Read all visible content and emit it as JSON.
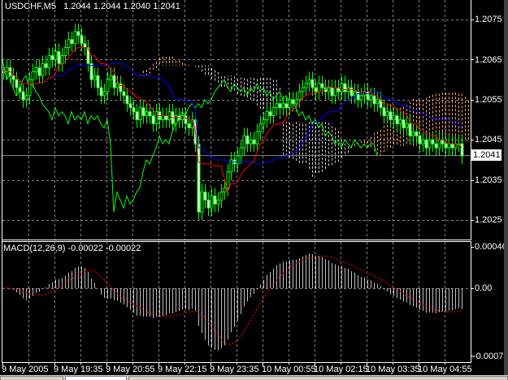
{
  "header": {
    "symbol": "USDCHF,M5",
    "ohlc": "1.2044 1.2044 1.2040 1.2041"
  },
  "current_price": "1.2041",
  "colors": {
    "background": "#000000",
    "grid": "#808080",
    "candle": "#00ff00",
    "tenkan": "#ff0000",
    "kijun": "#0000ff",
    "chikou": "#00ff00",
    "cloud_up": "#f4a460",
    "cloud_down": "#d8bfd8",
    "macd_histogram": "#c0c0c0",
    "macd_signal": "#ff0000"
  },
  "chart_data": [
    {
      "type": "candlestick",
      "title": "USDCHF,M5",
      "indicator": "Ichimoku",
      "ylim": [
        1.2025,
        1.2075
      ],
      "y_ticks": [
        "1.2075",
        "1.2065",
        "1.2055",
        "1.2045",
        "1.2035",
        "1.2025"
      ],
      "x_tick_labels": [
        "9 May 2005",
        "9 May 19:35",
        "9 May 20:55",
        "9 May 22:15",
        "9 May 23:35",
        "10 May 00:55",
        "10 May 02:15",
        "10 May 03:35",
        "10 May 04:55"
      ],
      "bar_interval_minutes": 5,
      "grid": true,
      "close": [
        1.2062,
        1.2063,
        1.2061,
        1.206,
        1.2058,
        1.2057,
        1.2055,
        1.2056,
        1.206,
        1.2062,
        1.2063,
        1.2061,
        1.2064,
        1.2063,
        1.2066,
        1.2065,
        1.2067,
        1.2064,
        1.2066,
        1.2068,
        1.207,
        1.2069,
        1.2072,
        1.2071,
        1.2069,
        1.2068,
        1.2064,
        1.206,
        1.2061,
        1.2058,
        1.2056,
        1.2057,
        1.206,
        1.2061,
        1.2058,
        1.2059,
        1.2057,
        1.2056,
        1.2054,
        1.2053,
        1.2052,
        1.205,
        1.2053,
        1.2051,
        1.2052,
        1.2051,
        1.2049,
        1.2052,
        1.205,
        1.2051,
        1.205,
        1.2052,
        1.2049,
        1.2051,
        1.205,
        1.2051,
        1.2049,
        1.2048,
        1.205,
        1.2044,
        1.2027,
        1.2032,
        1.203,
        1.2028,
        1.2031,
        1.2029,
        1.203,
        1.2032,
        1.2033,
        1.2037,
        1.204,
        1.2039,
        1.2041,
        1.2043,
        1.2046,
        1.2044,
        1.2045,
        1.2044,
        1.2047,
        1.2049,
        1.205,
        1.2052,
        1.2051,
        1.2053,
        1.2054,
        1.2053,
        1.2054,
        1.2053,
        1.2055,
        1.2054,
        1.2055,
        1.2057,
        1.2058,
        1.2059,
        1.206,
        1.2058,
        1.2057,
        1.2059,
        1.2058,
        1.2057,
        1.2058,
        1.2056,
        1.2058,
        1.2057,
        1.2059,
        1.2057,
        1.2058,
        1.2056,
        1.2057,
        1.2055,
        1.2056,
        1.2057,
        1.2055,
        1.2056,
        1.2054,
        1.2055,
        1.2053,
        1.2051,
        1.2052,
        1.205,
        1.2051,
        1.2049,
        1.205,
        1.2048,
        1.2049,
        1.2046,
        1.2047,
        1.2046,
        1.2044,
        1.2045,
        1.2043,
        1.2045,
        1.2044,
        1.2043,
        1.2045,
        1.2044,
        1.2043,
        1.2044,
        1.2043,
        1.2044,
        1.2044,
        1.2041
      ],
      "last_bar": {
        "open": 1.2044,
        "high": 1.2044,
        "low": 1.204,
        "close": 1.2041
      }
    },
    {
      "type": "bar",
      "title": "MACD(12,26,9)",
      "values_label": "-0.00022 -0.00022",
      "ylim": [
        -0.00075,
        0.00046
      ],
      "y_ticks": [
        "0.00046",
        "0.00",
        "-0.00075"
      ],
      "grid": true
    }
  ],
  "macd": {
    "label": "MACD(12,26,9) -0.00022 -0.00022"
  }
}
